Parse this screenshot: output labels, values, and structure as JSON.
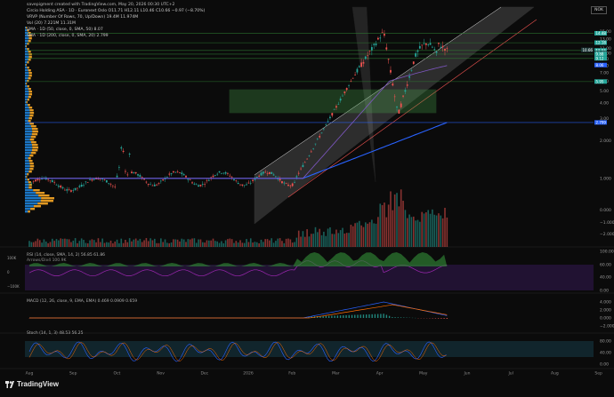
{
  "credit": "savepigment created with TradingView.com, May 20, 2026 00:30 UTC+2",
  "brand": "TradingView",
  "currency": "NOK",
  "legend": [
    "Circio Holding ASA · 1D · Euronext Oslo  O11.71 H12.11 L10.46 C10.66 −0.97 (−8.70%)",
    "VRVP (Number Of Rows, 70, Up/Down)  19.4M  11.974M",
    "Vol (20)  7.221M  11.31M",
    "SMA · 1D (50, close, 0, SMA, 50)  8.07",
    "SMA · 1D (200, close, 0, SMA, 20)  2.799"
  ],
  "panes": {
    "rsi": {
      "label": "RSI (14, close, SMA, 14, 2)  56.85  61.86",
      "sub": "Arrows/Div4  100.9K",
      "ticks": [
        "100.00",
        "60.00",
        "40.00",
        "0.00"
      ],
      "side": [
        "100K",
        "0",
        "−100K"
      ]
    },
    "macd": {
      "label": "MACD (12, 26, close, 9, EMA, EMA)  0.469  0.0909  0.659",
      "ticks": [
        "4.000",
        "2.000",
        "0.000",
        "−2.000"
      ]
    },
    "stoch": {
      "label": "Stoch (14, 1, 3)  48.53  56.25",
      "ticks": [
        "80.00",
        "40.00",
        "0.00"
      ]
    }
  },
  "colors": {
    "up": "#26a69a",
    "down": "#ef5350",
    "channel": "#ffffff",
    "zone": "#4caf50",
    "sma50": "#7e57c2",
    "sma200": "#2962ff",
    "rsi": "#9c27b0",
    "macd": "#2962ff",
    "signal": "#ff6d00"
  },
  "chart_data": {
    "type": "candlestick",
    "title": "Circio Holding ASA · 1D · Euronext Oslo",
    "x_labels": [
      "Aug",
      "Sep",
      "Oct",
      "Nov",
      "Dec",
      "2026",
      "Feb",
      "Mar",
      "Apr",
      "May",
      "Jun",
      "Jul",
      "Aug",
      "Sep",
      "Oct"
    ],
    "y_scale": "log",
    "y_ticks": [
      15.0,
      13.0,
      11.0,
      10.0,
      9.0,
      8.0,
      7.0,
      6.0,
      5.0,
      4.0,
      3.0,
      2.0,
      1.0,
      0.0,
      "−1.000",
      "−2.000"
    ],
    "price_labels": [
      {
        "value": "14.48",
        "color": "#26a69a"
      },
      {
        "value": "12.18",
        "color": "#26a69a"
      },
      {
        "value": "10.56",
        "color": "#26a69a"
      },
      {
        "value": "10.28",
        "color": "#26a69a"
      },
      {
        "value": "10.04",
        "color": "#1e3a3a"
      },
      {
        "value": "9.88",
        "color": "#26a69a"
      },
      {
        "value": "9.12",
        "color": "#26a69a"
      },
      {
        "value": "8.06",
        "color": "#2962ff"
      },
      {
        "value": "5.95",
        "color": "#26a69a"
      },
      {
        "value": "2.799",
        "color": "#2962ff"
      }
    ],
    "close_label": "10.66",
    "series": [
      {
        "name": "Circio Holding ASA",
        "segments": [
          {
            "from_date": "Aug",
            "to_date": "Feb",
            "close": 0.9,
            "volatility": "low"
          },
          {
            "from_date": "Feb",
            "to_date": "Mar 25",
            "close": 6.5,
            "trend": "up"
          },
          {
            "date": "Apr 3",
            "high": 15.0
          },
          {
            "date": "Apr 10",
            "low": 2.8
          },
          {
            "date": "May 15",
            "high": 12.2
          },
          {
            "date": "May 19",
            "close": 10.66
          }
        ]
      },
      {
        "name": "SMA 50",
        "value": 8.07
      },
      {
        "name": "SMA 200",
        "value": 2.799
      }
    ]
  }
}
